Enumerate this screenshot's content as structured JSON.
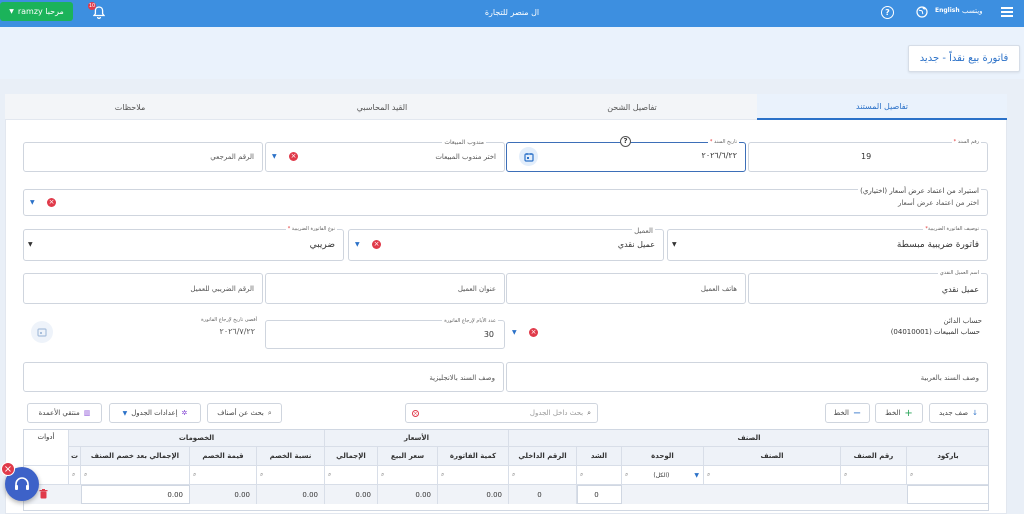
{
  "topbar": {
    "user_button_label": "ramzy مرحبا",
    "notification_count": "10",
    "company_name": "ال منصر للتجارة",
    "help_icon": "help-circle-icon",
    "language_label": "English",
    "app_name": "ويتسب"
  },
  "page": {
    "title": "فاتورة بيع نقداً - جديد"
  },
  "tabs": [
    "تفاصيل المستند",
    "تفاصيل الشحن",
    "القيد المحاسبي",
    "ملاحظات"
  ],
  "form": {
    "doc_number_label": "رقم السند",
    "doc_number_value": "19",
    "doc_date_label": "تاريخ السند",
    "doc_date_value": "٢٠٢٦/٦/٢٢",
    "salesman_label": "مندوب المبيعات",
    "salesman_placeholder": "اختر مندوب المبيعات",
    "reference_placeholder": "الرقم المرجعي",
    "import_label": "استيراد من اعتماد عرض أسعار (اختياري)",
    "import_placeholder": "اختر من اعتماد عرض أسعار",
    "invoice_desc_label": "توصيف الفاتورة الضريبية",
    "invoice_desc_value": "فاتورة ضريبية مبسطة",
    "customer_label": "العميل",
    "customer_value": "عميل نقدي",
    "tax_invoice_type_label": "نوع الفاتورة الضريبية",
    "tax_invoice_type_value": "ضريبي",
    "cash_customer_name_label": "اسم العميل النقدي",
    "cash_customer_name_value": "عميل نقدي",
    "customer_phone_placeholder": "هاتف العميل",
    "customer_address_placeholder": "عنوان العميل",
    "customer_tax_number_placeholder": "الرقم الضريبي للعميل",
    "creditor_account_label": "حساب الدائن",
    "creditor_account_value": "حساب المبيعات (04010001)",
    "return_days_label": "عدد الأيام لإرجاع الفاتورة",
    "return_days_value": "30",
    "return_deadline_label": "أقصى تاريخ لإرجاع الفاتورة",
    "return_deadline_value": "٢٠٢٦/٧/٢٢",
    "desc_ar_placeholder": "وصف السند بالعربية",
    "desc_en_placeholder": "وصف السند بالانجليزية"
  },
  "toolbar": {
    "add_row": "صف جديد",
    "add_line": "الخط",
    "remove_line": "الخط",
    "table_search_placeholder": "بحث داخل الجدول",
    "search_items": "بحث عن أصناف",
    "table_settings": "إعدادات الجدول",
    "column_picker": "منتقي الأعمدة"
  },
  "grid": {
    "groups": {
      "item": "الصنف",
      "prices": "الأسعار",
      "discounts": "الخصومات",
      "tools": "أدوات"
    },
    "columns": [
      "باركود",
      "رقم الصنف",
      "الصنف",
      "الوحدة",
      "الشد",
      "الرقم الداخلي",
      "كمية الفاتورة",
      "سعر البيع",
      "الإجمالي",
      "نسبة الخصم",
      "قيمة الخصم",
      "الإجمالي بعد خصم الصنف",
      "ت"
    ],
    "unit_filter_value": "(الكل)",
    "row": {
      "pack": "0",
      "internal": "0",
      "qty": "0.00",
      "price": "0.00",
      "total": "0.00",
      "disc_pct": "0.00",
      "disc_val": "0.00",
      "net": "0.00"
    }
  }
}
